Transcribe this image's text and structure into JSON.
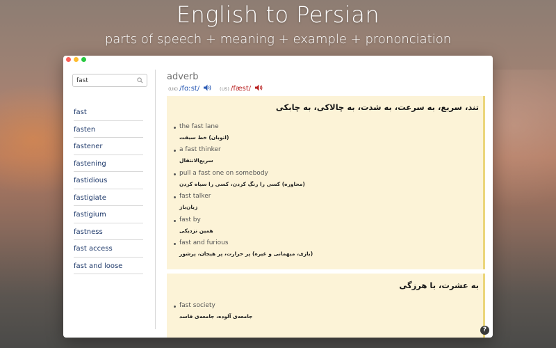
{
  "hero": {
    "title": "English to Persian",
    "subtitle": "parts of speech + meaning + example + prononciation"
  },
  "colors": {
    "link_blue": "#1f3a6b",
    "uk_ipa": "#2b5bb5",
    "us_ipa": "#b81e1e",
    "card_bg": "#fcf3d7",
    "card_border": "#ebd67c"
  },
  "search": {
    "value": "fast",
    "icon": "search-icon"
  },
  "word_list": [
    "fast",
    "fasten",
    "fastener",
    "fastening",
    "fastidious",
    "fastigiate",
    "fastigium",
    "fastness",
    "fast access",
    "fast and loose"
  ],
  "entry": {
    "part_of_speech": "adverb",
    "uk_tag": "(UK)",
    "uk_ipa": "/fɑːst/",
    "us_tag": "(US)",
    "us_ipa": "/fæst/",
    "speaker_icon": "speaker-icon",
    "senses": [
      {
        "meaning": "تند، سریع، به سرعت، به شدت، به چالاکی، به چابکی",
        "examples": [
          {
            "en": "the fast lane",
            "fa": "(اتوبان) خط سبقت"
          },
          {
            "en": "a fast thinker",
            "fa": "سریع‌الانتقال"
          },
          {
            "en": "pull a fast one on somebody",
            "fa": "(محاوره) کسی را رنگ کردن، کسی را سیاه کردن"
          },
          {
            "en": "fast talker",
            "fa": "زبان‌باز"
          },
          {
            "en": "fast by",
            "fa": "همین نزدیکی"
          },
          {
            "en": "fast and furious",
            "fa": "(بازی، میهمانی و غیره) پر حرارت، پر هیجان، پرشور"
          }
        ]
      },
      {
        "meaning": "به عشرت، با هرزگی",
        "examples": [
          {
            "en": "fast society",
            "fa": "جامعه‌ی آلوده، جامعه‌ی فاسد"
          }
        ]
      }
    ]
  },
  "help": {
    "label": "?"
  }
}
